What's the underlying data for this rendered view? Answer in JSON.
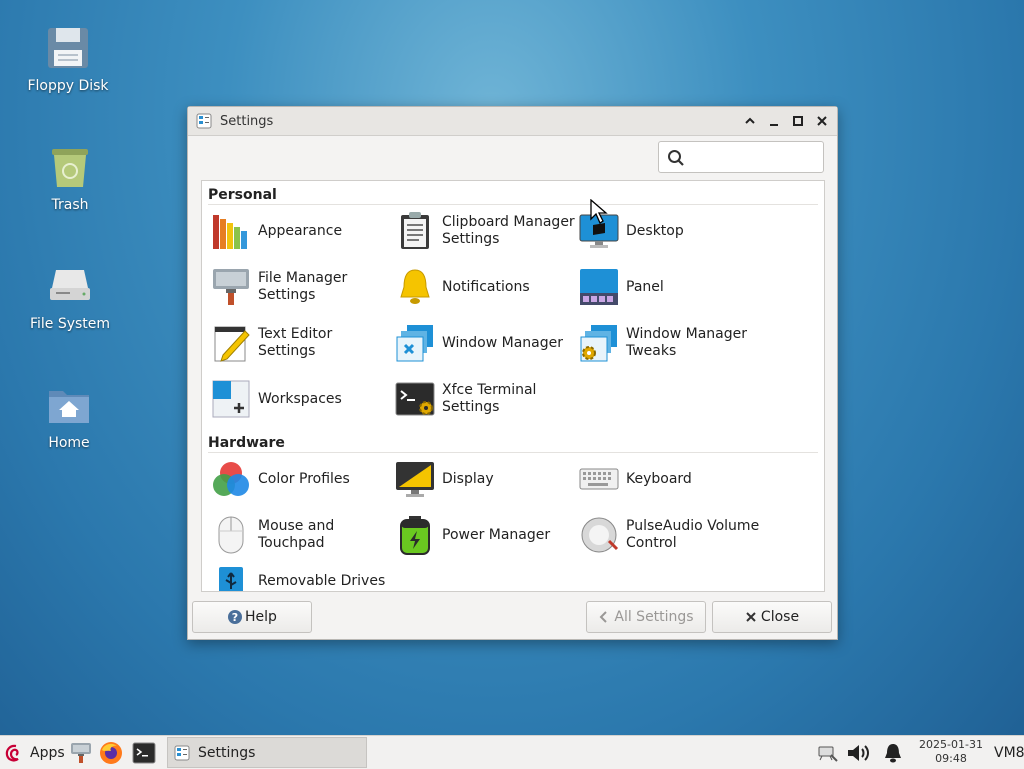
{
  "desktop": {
    "icons": [
      {
        "label": "Floppy Disk"
      },
      {
        "label": "Trash"
      },
      {
        "label": "File System"
      },
      {
        "label": "Home"
      }
    ]
  },
  "window": {
    "title": "Settings",
    "search": {
      "placeholder": "",
      "value": ""
    },
    "sections": {
      "personal": "Personal",
      "hardware": "Hardware"
    },
    "personal_items": [
      {
        "label": "Appearance",
        "icon": "appearance-icon"
      },
      {
        "label": "Clipboard Manager Settings",
        "icon": "clipboard-icon"
      },
      {
        "label": "Desktop",
        "icon": "desktop-icon"
      },
      {
        "label": "File Manager Settings",
        "icon": "file-manager-icon"
      },
      {
        "label": "Notifications",
        "icon": "bell-icon"
      },
      {
        "label": "Panel",
        "icon": "panel-icon"
      },
      {
        "label": "Text Editor Settings",
        "icon": "text-editor-icon"
      },
      {
        "label": "Window Manager",
        "icon": "window-manager-icon"
      },
      {
        "label": "Window Manager Tweaks",
        "icon": "window-manager-tweaks-icon"
      },
      {
        "label": "Workspaces",
        "icon": "workspaces-icon"
      },
      {
        "label": "Xfce Terminal Settings",
        "icon": "terminal-icon"
      }
    ],
    "hardware_items": [
      {
        "label": "Color Profiles",
        "icon": "color-profiles-icon"
      },
      {
        "label": "Display",
        "icon": "display-icon"
      },
      {
        "label": "Keyboard",
        "icon": "keyboard-icon"
      },
      {
        "label": "Mouse and Touchpad",
        "icon": "mouse-icon"
      },
      {
        "label": "Power Manager",
        "icon": "battery-icon"
      },
      {
        "label": "PulseAudio Volume Control",
        "icon": "speaker-icon"
      },
      {
        "label": "Removable Drives",
        "icon": "usb-icon"
      }
    ],
    "buttons": {
      "help": "Help",
      "all_settings": "All Settings",
      "close": "Close"
    }
  },
  "taskbar": {
    "apps_label": "Apps",
    "window_button": "Settings",
    "clock_date": "2025-01-31",
    "clock_time": "09:48",
    "host": "VM8"
  },
  "colors": {
    "desktop_bg": "#2b78ad",
    "accent": "#1e90d6"
  }
}
